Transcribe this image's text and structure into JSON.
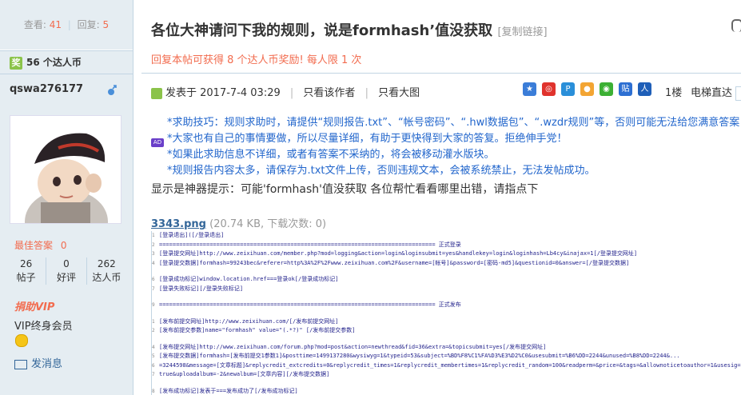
{
  "sidebar": {
    "views_label": "查看:",
    "views": "41",
    "replies_label": "回复:",
    "replies": "5",
    "coins_badge": "奖",
    "coins": "56 个达人币",
    "username": "qswa276177",
    "best_answer_label": "最佳答案",
    "best_answer": "0",
    "stats": [
      {
        "value": "26",
        "label": "帖子"
      },
      {
        "value": "0",
        "label": "好评"
      },
      {
        "value": "262",
        "label": "达人币"
      }
    ],
    "vip_badge": "捐助VIP",
    "vip_text": "VIP终身会员",
    "message_link": "发消息"
  },
  "post": {
    "title": "各位大神请问下我的规则，说是formhash’值没获取",
    "copy_link": "[复制链接]",
    "reward": "回复本帖可获得 8 个达人币奖励! 每人限 1 次",
    "posted_at": "发表于 2017-7-4 03:29",
    "only_author": "只看该作者",
    "large_image": "只看大图",
    "floor": "1楼",
    "elevator": "电梯直达",
    "ad_badge": "AD",
    "tips": [
      "*求助技巧：规则求助时，请提供“规则报告.txt”、“帐号密码”、“.hwl数据包”、“.wzdr规则”等，否则可能无法给您满意答案！",
      "*大家也有自己的事情要做，所以尽量详细，有助于更快得到大家的答复。拒绝伸手党！",
      "*如果此求助信息不详细，或者有答案不采纳的，将会被移动灌水版块。",
      "*规则报告内容太多，请保存为.txt文件上传，否则违规文本，会被系统禁止，无法发帖成功。"
    ],
    "body": "显示是神器提示：可能'formhash'值没获取    各位帮忙看看哪里出错，请指点下",
    "attachment_name": "3343.png",
    "attachment_info": "(20.74 KB, 下载次数: 0)"
  },
  "code_image": {
    "lines": [
      {
        "n": "1",
        "text": "[登录退出]([/登录退出]"
      },
      {
        "n": "2",
        "text": "================================================================================== 正式登录"
      },
      {
        "n": "3",
        "text": "[登录提交网址]http://www.zeixihuan.com/member.php?mod=logging&action=login&loginsubmit=yes&handlekey=login&loginhash=Lb4cy&inajax=1[/登录提交网址]"
      },
      {
        "n": "4",
        "text": "[登录提交数据]formhash=99243bec&referer=http%3A%2F%2Fwww.zeixihuan.com%2F&username=[帐号]&password=[密码-md5]&questionid=0&answer=[/登录提交数据]"
      },
      {
        "n": "",
        "text": ""
      },
      {
        "n": "6",
        "text": "[登录成功标记]window.location.href===登录ok[/登录成功标记]"
      },
      {
        "n": "7",
        "text": "[登录失败标记][/登录失败标记]"
      },
      {
        "n": "",
        "text": ""
      },
      {
        "n": "9",
        "text": "================================================================================== 正式发布"
      },
      {
        "n": "",
        "text": ""
      },
      {
        "n": "1",
        "text": "[发布前提交网址]http://www.zeixihuan.com/[/发布前提交网址]"
      },
      {
        "n": "2",
        "text": "[发布前提交参数]name=\"formhash\" value=\"(.*?)\" [/发布前提交参数]"
      },
      {
        "n": "",
        "text": ""
      },
      {
        "n": "4",
        "text": "[发布提交网址]http://www.zeixihuan.com/forum.php?mod=post&action=newthread&fid=36&extra=&topicsubmit=yes[/发布提交网址]"
      },
      {
        "n": "5",
        "text": "[发布提交数据]formhash=[发布前提交1参数1]&posttime=1499137280&wysiwyg=1&typeid=53&subject=%BD%F8%C1%FA%D3%E3%D2%C0&usesubmit=%B6%DD=2244&unused=%B8%DD=2244&..."
      },
      {
        "n": "6",
        "text": "=3244598&message=[文章标题]&replycredit_extcredits=0&replycredit_times=1&replycredit_membertimes=1&replycredit_random=100&readperm=&price=&tags=&allownoticetoauthor=1&usesig=1"
      },
      {
        "n": "7",
        "text": "true&uploadalbum=-2&newalbum=[文章内容][/发布提交数据]"
      },
      {
        "n": "",
        "text": ""
      },
      {
        "n": "8",
        "text": "[发布成功标记]发表于===发布成功了[/发布成功标记]"
      }
    ]
  },
  "colors": {
    "sidebar_bg": "#e5edf2",
    "accent_red": "#f26c4f",
    "link_blue": "#336699",
    "tip_blue": "#2266cc"
  }
}
